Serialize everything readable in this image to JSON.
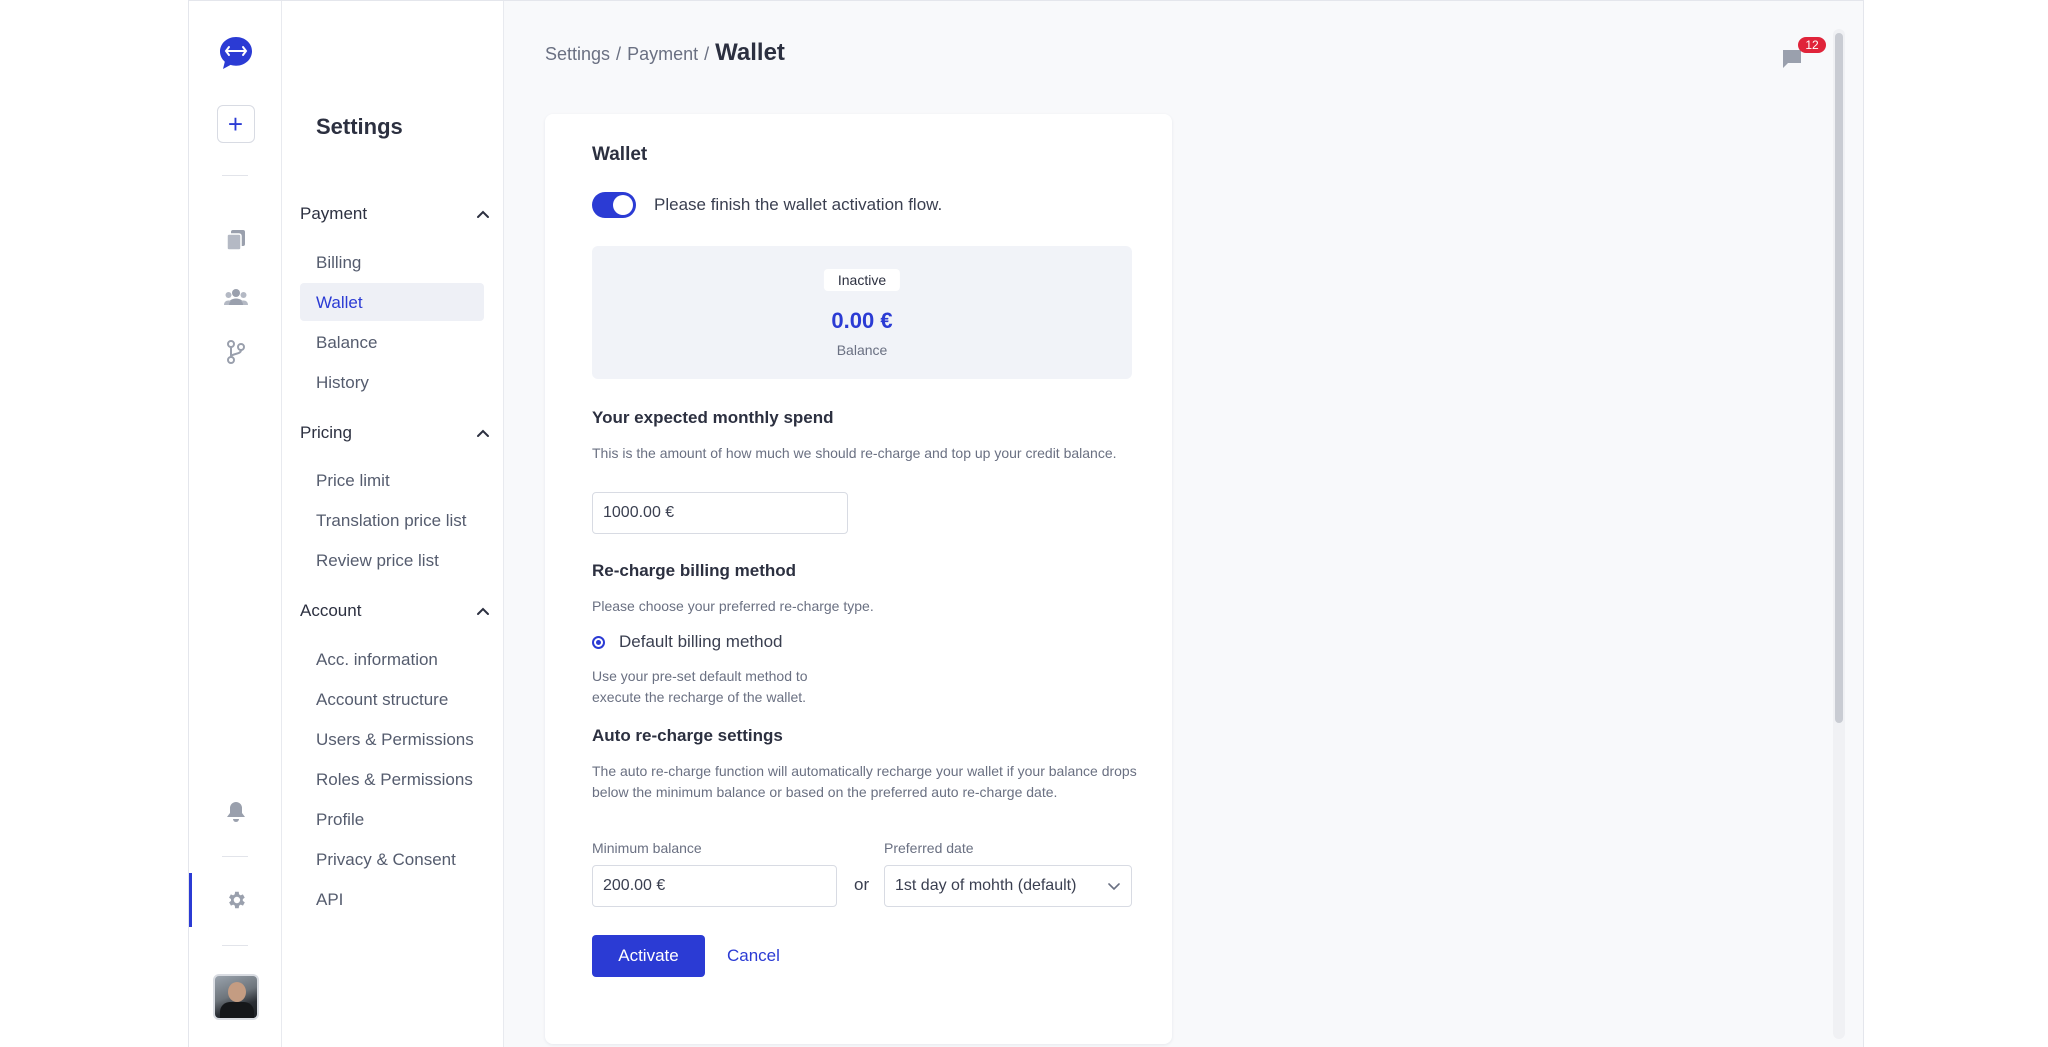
{
  "sidebar": {
    "title": "Settings",
    "groups": [
      {
        "label": "Payment",
        "items": [
          "Billing",
          "Wallet",
          "Balance",
          "History"
        ]
      },
      {
        "label": "Pricing",
        "items": [
          "Price limit",
          "Translation price list",
          "Review price list"
        ]
      },
      {
        "label": "Account",
        "items": [
          "Acc. information",
          "Account structure",
          "Users & Permissions",
          "Roles & Permissions",
          "Profile",
          "Privacy & Consent",
          "API"
        ]
      }
    ],
    "active_item": "Wallet"
  },
  "breadcrumb": {
    "part1": "Settings",
    "sep": "/",
    "part2": "Payment",
    "current": "Wallet"
  },
  "notifications": {
    "count": "12"
  },
  "card": {
    "title": "Wallet",
    "toggle_text": "Please finish the wallet activation flow.",
    "toggle_on": true,
    "balance": {
      "status": "Inactive",
      "amount": "0.00 €",
      "label": "Balance"
    },
    "monthly": {
      "title": "Your expected monthly spend",
      "desc": "This is the amount of how much we should re-charge and top up your credit balance.",
      "value": "1000.00 €"
    },
    "recharge": {
      "title": "Re-charge billing method",
      "desc": "Please choose your preferred re-charge type.",
      "option_label": "Default billing method",
      "option_desc": "Use your pre-set default method to execute the recharge of the wallet."
    },
    "auto": {
      "title": "Auto re-charge settings",
      "desc": "The auto re-charge function will automatically recharge your wallet if your balance drops below the minimum balance or based on the preferred auto re-charge date.",
      "min_label": "Minimum balance",
      "min_value": "200.00 €",
      "or_text": "or",
      "date_label": "Preferred date",
      "date_value": "1st day of mohth (default)"
    },
    "activate_label": "Activate",
    "cancel_label": "Cancel"
  },
  "colors": {
    "accent": "#2b3bd4",
    "badge": "#e0243a"
  },
  "icons": [
    "logo-chat-icon",
    "plus-icon",
    "documents-icon",
    "users-icon",
    "branch-icon",
    "bell-icon",
    "gear-icon",
    "avatar",
    "chevron-up-icon",
    "chevron-down-icon",
    "chat-bubble-icon"
  ]
}
